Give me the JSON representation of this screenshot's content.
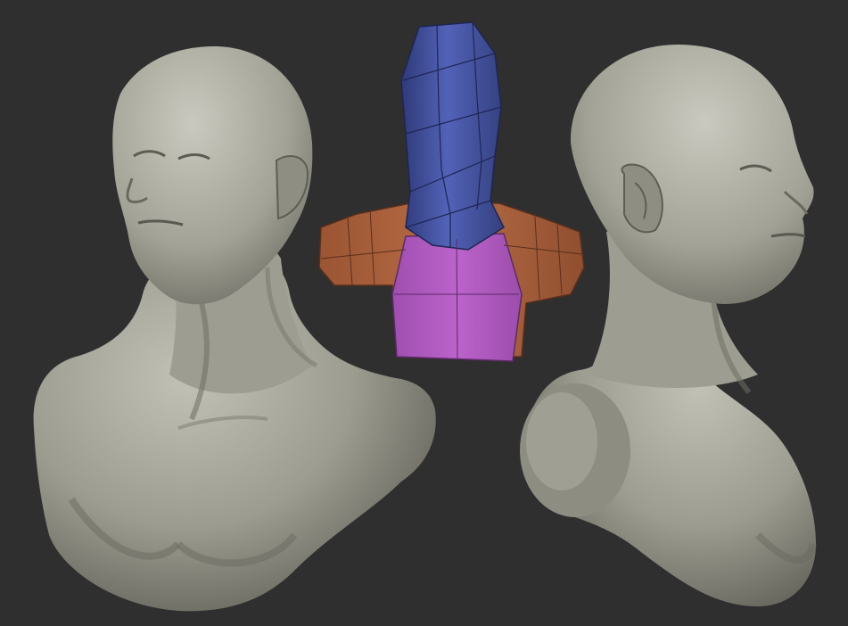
{
  "scene": {
    "background": "#2f2f2f",
    "sculpt_color": "#9c9b8f",
    "sculpt_shadow": "#5e5d55",
    "sculpt_highlight": "#c6c5ba",
    "lowpoly_head_color": "#4b58a6",
    "lowpoly_shoulder_color": "#b0653f",
    "lowpoly_chest_color": "#b05cc0",
    "lowpoly_edge_color": "#2c2c3a"
  }
}
